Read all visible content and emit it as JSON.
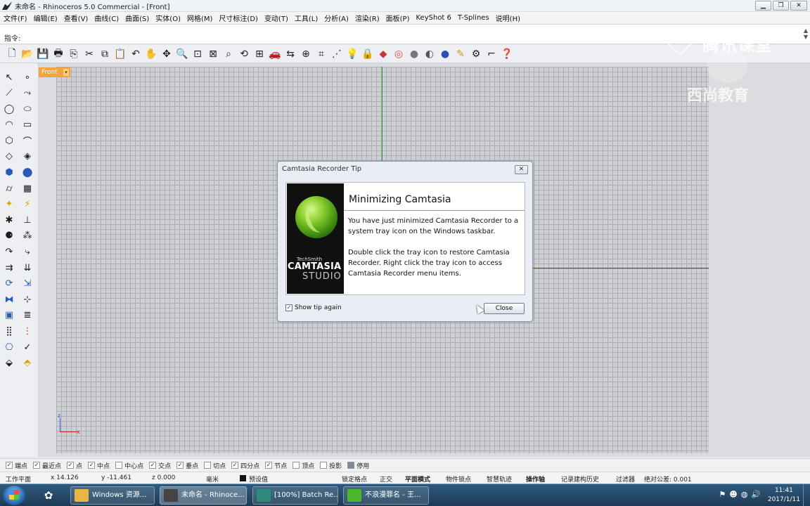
{
  "window": {
    "title": "未命名 - Rhinoceros 5.0 Commercial - [Front]",
    "controls": {
      "minimize": "▁",
      "restore": "❐",
      "close": "✕"
    }
  },
  "menu": [
    "文件(F)",
    "编辑(E)",
    "查看(V)",
    "曲线(C)",
    "曲面(S)",
    "实体(O)",
    "网格(M)",
    "尺寸标注(D)",
    "变动(T)",
    "工具(L)",
    "分析(A)",
    "渲染(R)",
    "面板(P)",
    "KeyShot 6",
    "T-Splines",
    "说明(H)"
  ],
  "command": {
    "label": "指令:"
  },
  "viewport": {
    "tab_label": "Front",
    "axis_z": "z",
    "axis_x": "x"
  },
  "watermark": {
    "line1": "腾讯课堂",
    "line2": "西尚教育"
  },
  "dialog": {
    "title": "Camtasia Recorder Tip",
    "close_glyph": "✕",
    "heading": "Minimizing Camtasia",
    "paragraph1": "You have just minimized Camtasia Recorder to a system tray icon on the Windows taskbar.",
    "paragraph2": "Double click the tray icon to restore Camtasia Recorder. Right click the tray icon to access Camtasia Recorder menu items.",
    "splash": {
      "small": "TechSmith",
      "big": "CAMTASIA",
      "sub": "STUDIO"
    },
    "checkbox_label": "Show tip again",
    "checkbox_checked": true,
    "button_label": "Close"
  },
  "osnaps": [
    {
      "label": "端点",
      "checked": true
    },
    {
      "label": "最近点",
      "checked": true
    },
    {
      "label": "点",
      "checked": true
    },
    {
      "label": "中点",
      "checked": true
    },
    {
      "label": "中心点",
      "checked": false
    },
    {
      "label": "交点",
      "checked": true
    },
    {
      "label": "垂点",
      "checked": true
    },
    {
      "label": "切点",
      "checked": false
    },
    {
      "label": "四分点",
      "checked": true
    },
    {
      "label": "节点",
      "checked": true
    },
    {
      "label": "顶点",
      "checked": false
    },
    {
      "label": "投影",
      "checked": false
    },
    {
      "label": "停用",
      "checked": false
    }
  ],
  "status": {
    "plane": "工作平面",
    "x": "x 14.126",
    "y": "y -11.461",
    "z": "z 0.000",
    "units": "毫米",
    "layer": "预设值",
    "grid_snap": "锁定格点",
    "ortho": "正交",
    "planar": "平面模式",
    "osnap": "物件锁点",
    "smarttrack": "智慧轨迹",
    "gumball": "操作轴",
    "history": "记录建构历史",
    "filter": "过滤器",
    "tolerance": "绝对公差: 0.001"
  },
  "taskbar": {
    "items": [
      {
        "label": "Windows 资源...",
        "color": "#e8b645"
      },
      {
        "label": "未命名 - Rhinoce...",
        "color": "#444444"
      },
      {
        "label": "[100%] Batch Re...",
        "color": "#2e8a7a"
      },
      {
        "label": "不浪漫罪名 - 王...",
        "color": "#4bb52b"
      }
    ],
    "time": "11:41",
    "date": "2017/1/11"
  },
  "colors": {
    "accent_tab": "#f1a53b",
    "axis_x": "#c21f1f",
    "axis_y": "#1fa31f"
  }
}
